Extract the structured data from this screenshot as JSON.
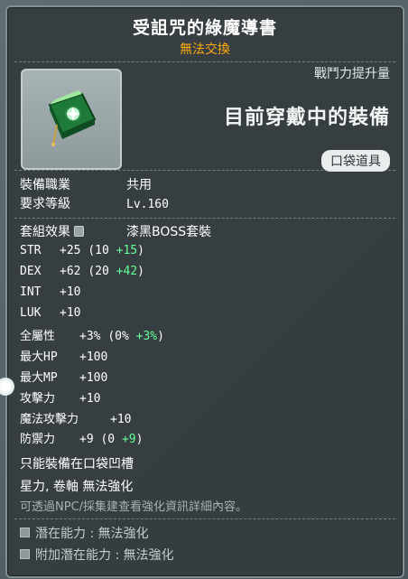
{
  "item": {
    "name": "受詛咒的綠魔導書",
    "trade_status": "無法交換",
    "icon": "cursed-green-spellbook-icon"
  },
  "compare": {
    "power_label": "戰鬥力提升量",
    "equipped_label": "目前穿戴中的裝備",
    "slot_badge": "口袋道具"
  },
  "requirements": {
    "job_label": "裝備職業",
    "job_value": "共用",
    "level_label": "要求等級",
    "level_value": "Lv.160"
  },
  "set": {
    "label": "套組效果",
    "name": "漆黑BOSS套裝"
  },
  "stats": {
    "str": {
      "name": "STR",
      "total": "+25",
      "base": "(10 ",
      "bonus": "+15",
      "close": ")"
    },
    "dex": {
      "name": "DEX",
      "total": "+62",
      "base": "(20 ",
      "bonus": "+42",
      "close": ")"
    },
    "int": {
      "name": "INT",
      "total": "+10"
    },
    "luk": {
      "name": "LUK",
      "total": "+10"
    },
    "all": {
      "name": "全屬性",
      "total": "+3%",
      "base": "(0% ",
      "bonus": "+3%",
      "close": ")"
    },
    "hp": {
      "name": "最大HP",
      "total": "+100"
    },
    "mp": {
      "name": "最大MP",
      "total": "+100"
    },
    "att": {
      "name": "攻擊力",
      "total": "+10"
    },
    "matt": {
      "name": "魔法攻擊力",
      "total": "+10"
    },
    "def": {
      "name": "防禦力",
      "total": "+9",
      "base": "(0 ",
      "bonus": "+9",
      "close": ")"
    }
  },
  "notes": {
    "slot_note": "只能裝備在口袋凹槽",
    "enhance_note": "星力, 卷軸 無法強化",
    "npc_note": "可透過NPC/採集建查看強化資訊詳細內容。"
  },
  "potential": {
    "label": "潛在能力",
    "value": "無法強化",
    "bonus_label": "附加潛在能力",
    "bonus_value": "無法強化",
    "separator": " : "
  },
  "colors": {
    "trade_status": "#ffaa11",
    "bonus_green": "#66ff99",
    "tooltip_bg": "#343c3f"
  }
}
